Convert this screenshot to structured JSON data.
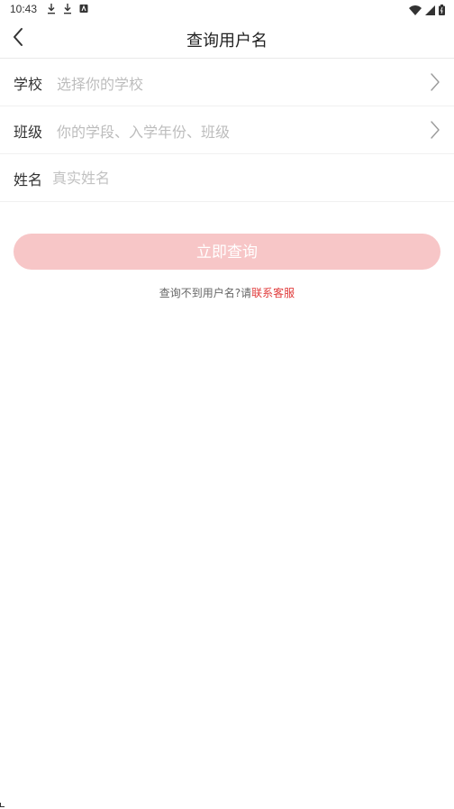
{
  "status_bar": {
    "time": "10:43",
    "icons_left": [
      "download-icon",
      "download-icon",
      "notification-icon"
    ],
    "icons_right": [
      "wifi-icon",
      "signal-icon",
      "battery-icon"
    ]
  },
  "header": {
    "title": "查询用户名",
    "back_icon": "chevron-left-icon"
  },
  "form": {
    "school": {
      "label": "学校",
      "placeholder": "选择你的学校"
    },
    "class": {
      "label": "班级",
      "placeholder": "你的学段、入学年份、班级"
    },
    "name": {
      "label": "姓名",
      "placeholder": "真实姓名"
    }
  },
  "submit": {
    "label": "立即查询",
    "color": "#f7c6c7"
  },
  "help": {
    "prefix": "查询不到用户名?请",
    "link": "联系客服",
    "link_color": "#e03a3a"
  }
}
